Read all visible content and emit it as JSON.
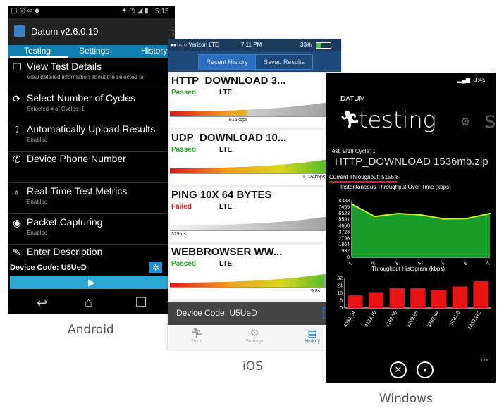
{
  "android": {
    "clock": "5:15",
    "app_title": "Datum v2.6.0.19",
    "tabs": [
      "Testing",
      "Settings",
      "History"
    ],
    "items": [
      {
        "title": "View Test Details",
        "subtitle": "View detailed information about the selected te"
      },
      {
        "title": "Select Number of Cycles",
        "subtitle": "Selected # of Cycles: 1"
      },
      {
        "title": "Automatically Upload Results",
        "subtitle": "Enabled"
      },
      {
        "title": "Device Phone Number",
        "subtitle": ""
      },
      {
        "title": "Real-Time Test Metrics",
        "subtitle": "Enabled"
      },
      {
        "title": "Packet Capturing",
        "subtitle": "Enabled"
      },
      {
        "title": "Enter Description",
        "subtitle": ""
      }
    ],
    "device_code": "Device Code: U5UeD",
    "caption": "Android"
  },
  "ios": {
    "carrier": "●●○○○ Verizon  LTE",
    "time": "7:11 PM",
    "battery": "33%",
    "segments": [
      "Recent History",
      "Saved Results"
    ],
    "results": [
      {
        "name": "HTTP_DOWNLOAD 3...",
        "status": "Passed",
        "network": "LTE",
        "value": "615kbps",
        "fill": 0.45
      },
      {
        "name": "UDP_DOWNLOAD 10...",
        "status": "Passed",
        "network": "LTE",
        "value": "1,024kbps",
        "fill": 1.0
      },
      {
        "name": "PING 10X 64 BYTES",
        "status": "Failed",
        "network": "LTE",
        "value": "329ms",
        "fill": 0.0
      },
      {
        "name": "WEBBROWSER WW...",
        "status": "Passed",
        "network": "LTE",
        "value": "9.8s",
        "fill": 0.9
      }
    ],
    "device_code": "Device Code: U5UeD",
    "tabbar": [
      "Tests",
      "Settings",
      "History"
    ],
    "caption": "iOS",
    "colors": {
      "passed": "#2aa32a",
      "failed": "#e82020"
    }
  },
  "windows": {
    "time": "1:45",
    "app_name": "DATUM",
    "pivot_title": "testing",
    "pivot_next": "se",
    "test_info": "Test: 9/18 Cycle: 1",
    "test_name": "HTTP_DOWNLOAD 1536mb.zip",
    "current_throughput": "Current Throughput: 5155.8",
    "chart1_title": "Instantaneous Throughput Over Time (kbps)",
    "chart2_title": "Throughput Histogram (kbps)",
    "caption": "Windows"
  },
  "chart_data": [
    {
      "type": "area",
      "title": "Instantaneous Throughput Over Time (kbps)",
      "x": [
        "1",
        "2",
        "3",
        "4",
        "5",
        "6",
        "7"
      ],
      "yticks": [
        "8388",
        "7455",
        "6523",
        "5591",
        "4660",
        "3728",
        "2796",
        "1864",
        "932",
        "0"
      ],
      "values": [
        7900,
        6050,
        6500,
        6300,
        5700,
        5750,
        6500
      ],
      "ylim": [
        0,
        8388
      ],
      "color": "#1a9c2a",
      "line_color": "#c8f02a"
    },
    {
      "type": "bar",
      "title": "Throughput Histogram (kbps)",
      "categories": [
        "4390.24",
        "4733.76",
        "5162.56",
        "5209.28",
        "5407.84",
        "5781.6",
        "7458.272"
      ],
      "yticks": [
        "32",
        "24",
        "16",
        "8",
        "0"
      ],
      "values": [
        14,
        17,
        22,
        22,
        20,
        24,
        30
      ],
      "ylim": [
        0,
        33
      ],
      "color": "#e81414"
    }
  ]
}
